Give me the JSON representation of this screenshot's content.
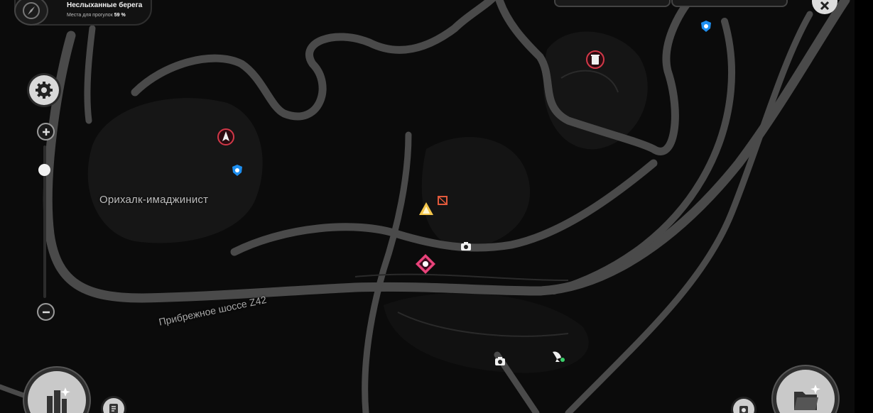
{
  "area": {
    "name": "Неслыханные берега",
    "progress_label": "Места для прогулок",
    "progress_value": "59 %"
  },
  "map_labels": {
    "region": "Орихалк-имаджинист",
    "road": "Прибрежное шоссе Z42"
  },
  "zoom": {
    "level": 0.84
  },
  "colors": {
    "background": "#0b0b0b",
    "road": "#4a4a4a",
    "terrain": "#161616",
    "poi_blue": "#1e8ff0",
    "poi_red": "#d23848",
    "poi_pink": "#e8437a",
    "poi_yellow": "#f3c54a"
  },
  "icons": [
    "compass-icon",
    "gear-icon",
    "plus-icon",
    "minus-icon",
    "close-icon",
    "city-icon",
    "folder-icon",
    "notes-icon",
    "photo-icon",
    "rocket-icon",
    "blue-shield-icon",
    "trash-bin-icon",
    "bell-icon",
    "crate-icon",
    "camera-icon",
    "pink-diamond-icon",
    "satellite-dish-icon"
  ]
}
